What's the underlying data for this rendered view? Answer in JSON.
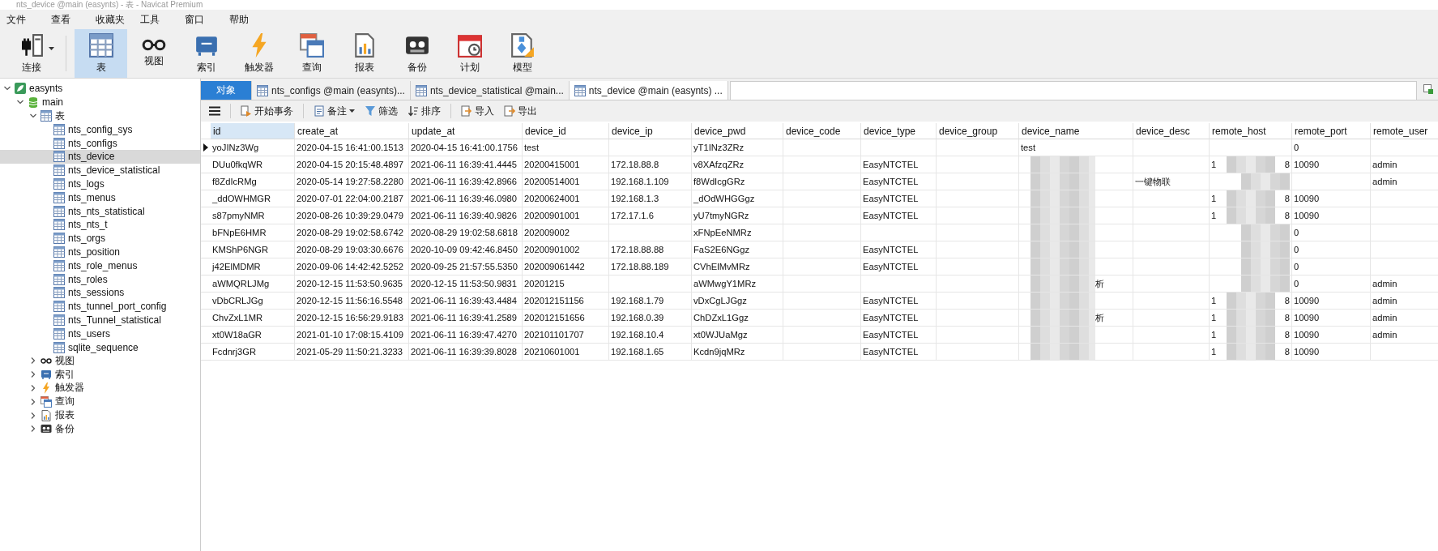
{
  "window": {
    "title": "nts_device @main (easynts) - 表 - Navicat Premium"
  },
  "menu": [
    "文件",
    "查看",
    "收藏夹",
    "工具",
    "窗口",
    "帮助"
  ],
  "toolbar": [
    {
      "kind": "connect",
      "label": "连接",
      "selected": false,
      "dropdown": true
    },
    {
      "kind": "table",
      "label": "表",
      "selected": true,
      "dropdown": false
    },
    {
      "kind": "view",
      "label": "视图",
      "selected": false,
      "dropdown": false
    },
    {
      "kind": "index",
      "label": "索引",
      "selected": false,
      "dropdown": false
    },
    {
      "kind": "trigger",
      "label": "触发器",
      "selected": false,
      "dropdown": false
    },
    {
      "kind": "query",
      "label": "查询",
      "selected": false,
      "dropdown": false
    },
    {
      "kind": "report",
      "label": "报表",
      "selected": false,
      "dropdown": false
    },
    {
      "kind": "backup",
      "label": "备份",
      "selected": false,
      "dropdown": false
    },
    {
      "kind": "schedule",
      "label": "计划",
      "selected": false,
      "dropdown": false
    },
    {
      "kind": "model",
      "label": "模型",
      "selected": false,
      "dropdown": false
    }
  ],
  "sidebar": {
    "tree": [
      {
        "kind": "connection",
        "label": "easynts",
        "expanded": true,
        "selected": false,
        "children": [
          {
            "kind": "database",
            "label": "main",
            "expanded": true,
            "selected": false,
            "children": [
              {
                "kind": "table",
                "label": "表",
                "expanded": true,
                "selected": false,
                "children": [
                  {
                    "kind": "table",
                    "label": "nts_config_sys",
                    "selected": false
                  },
                  {
                    "kind": "table",
                    "label": "nts_configs",
                    "selected": false
                  },
                  {
                    "kind": "table",
                    "label": "nts_device",
                    "selected": true
                  },
                  {
                    "kind": "table",
                    "label": "nts_device_statistical",
                    "selected": false
                  },
                  {
                    "kind": "table",
                    "label": "nts_logs",
                    "selected": false
                  },
                  {
                    "kind": "table",
                    "label": "nts_menus",
                    "selected": false
                  },
                  {
                    "kind": "table",
                    "label": "nts_nts_statistical",
                    "selected": false
                  },
                  {
                    "kind": "table",
                    "label": "nts_nts_t",
                    "selected": false
                  },
                  {
                    "kind": "table",
                    "label": "nts_orgs",
                    "selected": false
                  },
                  {
                    "kind": "table",
                    "label": "nts_position",
                    "selected": false
                  },
                  {
                    "kind": "table",
                    "label": "nts_role_menus",
                    "selected": false
                  },
                  {
                    "kind": "table",
                    "label": "nts_roles",
                    "selected": false
                  },
                  {
                    "kind": "table",
                    "label": "nts_sessions",
                    "selected": false
                  },
                  {
                    "kind": "table",
                    "label": "nts_tunnel_port_config",
                    "selected": false
                  },
                  {
                    "kind": "table",
                    "label": "nts_Tunnel_statistical",
                    "selected": false
                  },
                  {
                    "kind": "table",
                    "label": "nts_users",
                    "selected": false
                  },
                  {
                    "kind": "table",
                    "label": "sqlite_sequence",
                    "selected": false
                  }
                ]
              },
              {
                "kind": "view",
                "label": "视图",
                "expanded": false,
                "selected": false
              },
              {
                "kind": "index",
                "label": "索引",
                "expanded": false,
                "selected": false
              },
              {
                "kind": "trigger",
                "label": "触发器",
                "expanded": false,
                "selected": false
              },
              {
                "kind": "query",
                "label": "查询",
                "expanded": false,
                "selected": false
              },
              {
                "kind": "report",
                "label": "报表",
                "expanded": false,
                "selected": false
              },
              {
                "kind": "backup",
                "label": "备份",
                "expanded": false,
                "selected": false
              }
            ]
          }
        ]
      }
    ]
  },
  "objects_tab": {
    "label": "对象"
  },
  "tabs": [
    {
      "kind": "table",
      "label": "nts_configs @main (easynts)...",
      "selected": false
    },
    {
      "kind": "table",
      "label": "nts_device_statistical @main...",
      "selected": false
    },
    {
      "kind": "table",
      "label": "nts_device @main (easynts) ...",
      "selected": true
    }
  ],
  "actions": [
    {
      "kind": "menu"
    },
    {
      "kind": "transaction",
      "label": "开始事务"
    },
    {
      "kind": "memo",
      "label": "备注",
      "dropdown": true
    },
    {
      "kind": "filter",
      "label": "筛选"
    },
    {
      "kind": "sort",
      "label": "排序"
    },
    {
      "kind": "import",
      "label": "导入"
    },
    {
      "kind": "export",
      "label": "导出"
    }
  ],
  "table": {
    "columns": [
      {
        "label": "id",
        "selected": true
      },
      {
        "label": "create_at",
        "selected": false
      },
      {
        "label": "update_at",
        "selected": false
      },
      {
        "label": "device_id",
        "selected": false
      },
      {
        "label": "device_ip",
        "selected": false
      },
      {
        "label": "device_pwd",
        "selected": false
      },
      {
        "label": "device_code",
        "selected": false
      },
      {
        "label": "device_type",
        "selected": false
      },
      {
        "label": "device_group",
        "selected": false
      },
      {
        "label": "device_name",
        "selected": false
      },
      {
        "label": "device_desc",
        "selected": false
      },
      {
        "label": "remote_host",
        "selected": false
      },
      {
        "label": "remote_port",
        "selected": false
      },
      {
        "label": "remote_user",
        "selected": false
      }
    ],
    "rows": [
      {
        "current": true,
        "cells": [
          "yoJINz3Wg",
          "2020-04-15 16:41:00.1513",
          "2020-04-15 16:41:00.1756",
          "test",
          null,
          "yT1INz3ZRz",
          null,
          null,
          null,
          "test",
          null,
          null,
          "0",
          null
        ]
      },
      {
        "current": false,
        "cells": [
          "DUu0fkqWR",
          "2020-04-15 20:15:48.4897",
          "2021-06-11 16:39:41.4445",
          "20200415001",
          "172.18.88.8",
          "v8XAfzqZRz",
          null,
          "EasyNTCTEL",
          null,
          {
            "redacted": true
          },
          null,
          {
            "redacted": true,
            "before": "1",
            "after": "8"
          },
          "10090",
          "admin"
        ]
      },
      {
        "current": false,
        "cells": [
          "f8ZdIcRMg",
          "2020-05-14 19:27:58.2280",
          "2021-06-11 16:39:42.8966",
          "20200514001",
          "192.168.1.109",
          "f8WdIcgGRz",
          null,
          "EasyNTCTEL",
          null,
          {
            "redacted": true
          },
          "一键物联",
          {
            "redacted": true
          },
          null,
          "admin"
        ]
      },
      {
        "current": false,
        "cells": [
          "_ddOWHMGR",
          "2020-07-01 22:04:00.2187",
          "2021-06-11 16:39:46.0980",
          "20200624001",
          "192.168.1.3",
          "_dOdWHGGgz",
          null,
          "EasyNTCTEL",
          null,
          {
            "redacted": true
          },
          null,
          {
            "redacted": true,
            "before": "1",
            "after": "8"
          },
          "10090",
          null
        ]
      },
      {
        "current": false,
        "cells": [
          "s87pmyNMR",
          "2020-08-26 10:39:29.0479",
          "2021-06-11 16:39:40.9826",
          "20200901001",
          "172.17.1.6",
          "yU7tmyNGRz",
          null,
          "EasyNTCTEL",
          null,
          {
            "redacted": true
          },
          null,
          {
            "redacted": true,
            "before": "1",
            "after": "8"
          },
          "10090",
          null
        ]
      },
      {
        "current": false,
        "cells": [
          "bFNpE6HMR",
          "2020-08-29 19:02:58.6742",
          "2020-08-29 19:02:58.6818",
          "202009002",
          null,
          "xFNpEeNMRz",
          null,
          null,
          null,
          {
            "redacted": true
          },
          null,
          {
            "redacted": true
          },
          "0",
          null
        ]
      },
      {
        "current": false,
        "cells": [
          "KMShP6NGR",
          "2020-08-29 19:03:30.6676",
          "2020-10-09 09:42:46.8450",
          "20200901002",
          "172.18.88.88",
          "FaS2E6NGgz",
          null,
          "EasyNTCTEL",
          null,
          {
            "redacted": true
          },
          null,
          {
            "redacted": true
          },
          "0",
          null
        ]
      },
      {
        "current": false,
        "cells": [
          "j42ElMDMR",
          "2020-09-06 14:42:42.5252",
          "2020-09-25 21:57:55.5350",
          "202009061442",
          "172.18.88.189",
          "CVhElMvMRz",
          null,
          "EasyNTCTEL",
          null,
          {
            "redacted": true
          },
          null,
          {
            "redacted": true
          },
          "0",
          null
        ]
      },
      {
        "current": false,
        "cells": [
          "aWMQRLJMg",
          "2020-12-15 11:53:50.9635",
          "2020-12-15 11:53:50.9831",
          "20201215",
          null,
          "aWMwgY1MRz",
          null,
          null,
          null,
          {
            "redacted": true,
            "after": "析"
          },
          null,
          {
            "redacted": true
          },
          "0",
          "admin"
        ]
      },
      {
        "current": false,
        "cells": [
          "vDbCRLJGg",
          "2020-12-15 11:56:16.5548",
          "2021-06-11 16:39:43.4484",
          "202012151156",
          "192.168.1.79",
          "vDxCgLJGgz",
          null,
          "EasyNTCTEL",
          null,
          {
            "redacted": true
          },
          null,
          {
            "redacted": true,
            "before": "1",
            "after": "8"
          },
          "10090",
          "admin"
        ]
      },
      {
        "current": false,
        "cells": [
          "ChvZxL1MR",
          "2020-12-15 16:56:29.9183",
          "2021-06-11 16:39:41.2589",
          "202012151656",
          "192.168.0.39",
          "ChDZxL1Ggz",
          null,
          "EasyNTCTEL",
          null,
          {
            "redacted": true,
            "after": "析"
          },
          null,
          {
            "redacted": true,
            "before": "1",
            "after": "8"
          },
          "10090",
          "admin"
        ]
      },
      {
        "current": false,
        "cells": [
          "xt0W18aGR",
          "2021-01-10 17:08:15.4109",
          "2021-06-11 16:39:47.4270",
          "202101101707",
          "192.168.10.4",
          "xt0WJUaMgz",
          null,
          "EasyNTCTEL",
          null,
          {
            "redacted": true
          },
          null,
          {
            "redacted": true,
            "before": "1",
            "after": "8"
          },
          "10090",
          "admin"
        ]
      },
      {
        "current": false,
        "cells": [
          "Fcdnrj3GR",
          "2021-05-29 11:50:21.3233",
          "2021-06-11 16:39:39.8028",
          "20210601001",
          "192.168.1.65",
          "Kcdn9jqMRz",
          null,
          "EasyNTCTEL",
          null,
          {
            "redacted": true
          },
          null,
          {
            "redacted": true,
            "before": "1",
            "after": "8"
          },
          "10090",
          null
        ]
      }
    ]
  }
}
